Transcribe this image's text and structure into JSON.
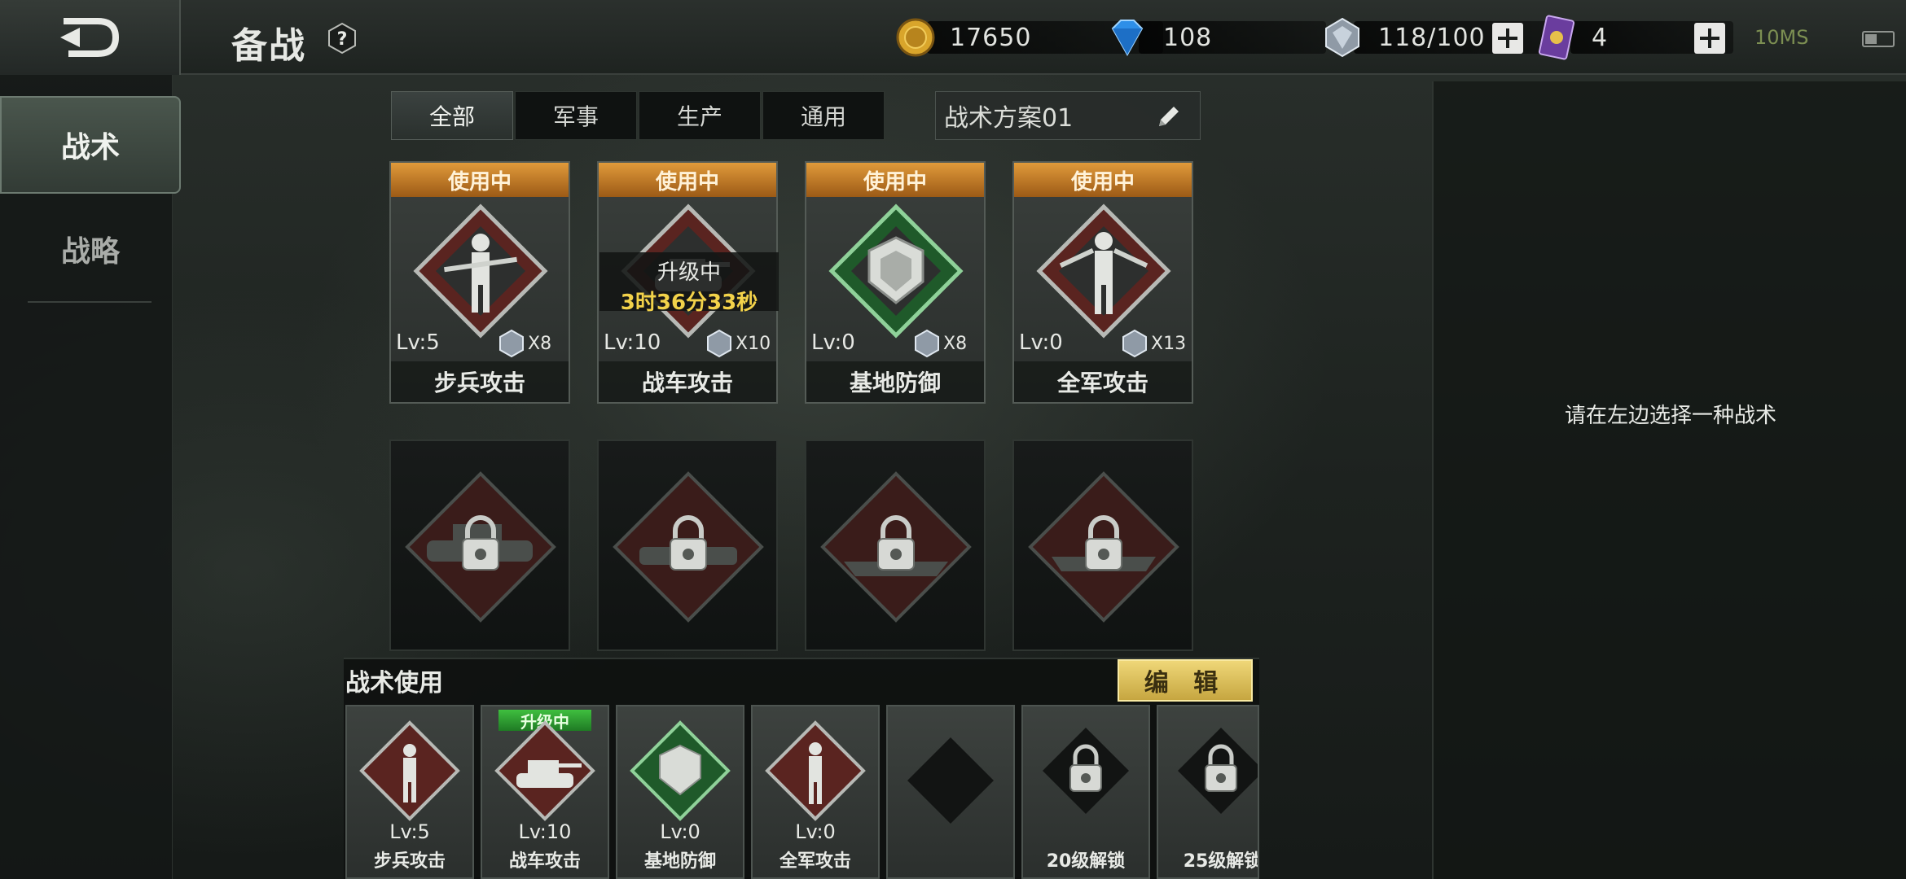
{
  "header": {
    "title": "备战",
    "help_icon": "question-hex-icon",
    "resources": {
      "gold": "17650",
      "diamond": "108",
      "crystal": "118/100",
      "card": "4"
    },
    "ping": "10MS"
  },
  "sidebar": {
    "tabs": [
      {
        "label": "战术",
        "active": true
      },
      {
        "label": "战略",
        "active": false
      }
    ]
  },
  "filters": {
    "tabs": [
      "全部",
      "军事",
      "生产",
      "通用"
    ],
    "active": "全部",
    "plan_name": "战术方案01"
  },
  "tactic_cards": [
    {
      "status": "使用中",
      "level": "Lv:5",
      "cost": "X8",
      "name": "步兵攻击"
    },
    {
      "status": "使用中",
      "level": "Lv:10",
      "cost": "X10",
      "name": "战车攻击"
    },
    {
      "status": "使用中",
      "level": "Lv:0",
      "cost": "X8",
      "name": "基地防御"
    },
    {
      "status": "使用中",
      "level": "Lv:0",
      "cost": "X13",
      "name": "全军攻击"
    }
  ],
  "upgrade_overlay": {
    "label": "升级中",
    "timer": "3时36分33秒"
  },
  "right_panel": {
    "hint": "请在左边选择一种战术"
  },
  "dock": {
    "title": "战术使用",
    "edit_label": "编 辑",
    "slots": [
      {
        "level": "Lv:5",
        "name": "步兵攻击"
      },
      {
        "tag": "升级中",
        "level": "Lv:10",
        "name": "战车攻击"
      },
      {
        "level": "Lv:0",
        "name": "基地防御"
      },
      {
        "level": "Lv:0",
        "name": "全军攻击"
      },
      {},
      {
        "name": "20级解锁"
      },
      {
        "name": "25级解锁"
      }
    ]
  },
  "colors": {
    "status_orange": "#c87a26",
    "upgrade_green": "#2f9f33",
    "timer_yellow": "#f3d24a",
    "edit_gold": "#e1c35c"
  }
}
